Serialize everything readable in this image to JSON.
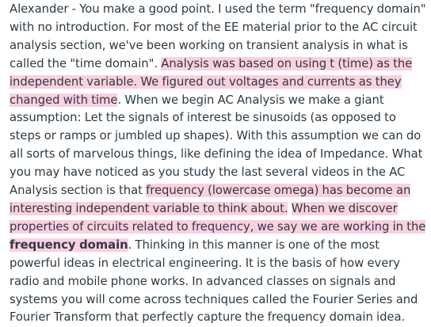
{
  "comment": {
    "segments": [
      {
        "text": "Alexander - You make a good point. I used the term \"frequency domain\" with no introduction. For most of the EE material prior to the AC circuit analysis section, we've been working on transient analysis in what is called the \"time domain\". ",
        "highlight": false,
        "bold": false
      },
      {
        "text": "Analysis was based on using t (time) as the independent variable. We figured out voltages and currents as they changed with time",
        "highlight": true,
        "bold": false
      },
      {
        "text": ". When we begin AC Analysis we make a giant assumption: Let the signals of interest be sinusoids (as opposed to steps or ramps or jumbled up shapes). With this assumption we can do all sorts of marvelous things, like defining the idea of Impedance. What you may have noticed as you study the last several videos in the AC Analysis section is that ",
        "highlight": false,
        "bold": false
      },
      {
        "text": "frequency (lowercase omega) has become an interesting independent variable to think about.",
        "highlight": true,
        "bold": false
      },
      {
        "text": " ",
        "highlight": false,
        "bold": false
      },
      {
        "text": "When we discover properties of circuits related to frequency, we say we are working in the ",
        "highlight": true,
        "bold": false
      },
      {
        "text": "frequency domain",
        "highlight": true,
        "bold": true
      },
      {
        "text": ". Thinking in this manner is one of the most powerful ideas in electrical engineering. It is the basis of how every radio and mobile phone works. In advanced classes on signals and systems you will come across techniques called the Fourier Series and Fourier Transform that perfectly capture the frequency domain idea.",
        "highlight": false,
        "bold": false
      }
    ],
    "colors": {
      "text": "#2d3b45",
      "highlight": "#fbd0df",
      "background": "#ffffff"
    }
  }
}
